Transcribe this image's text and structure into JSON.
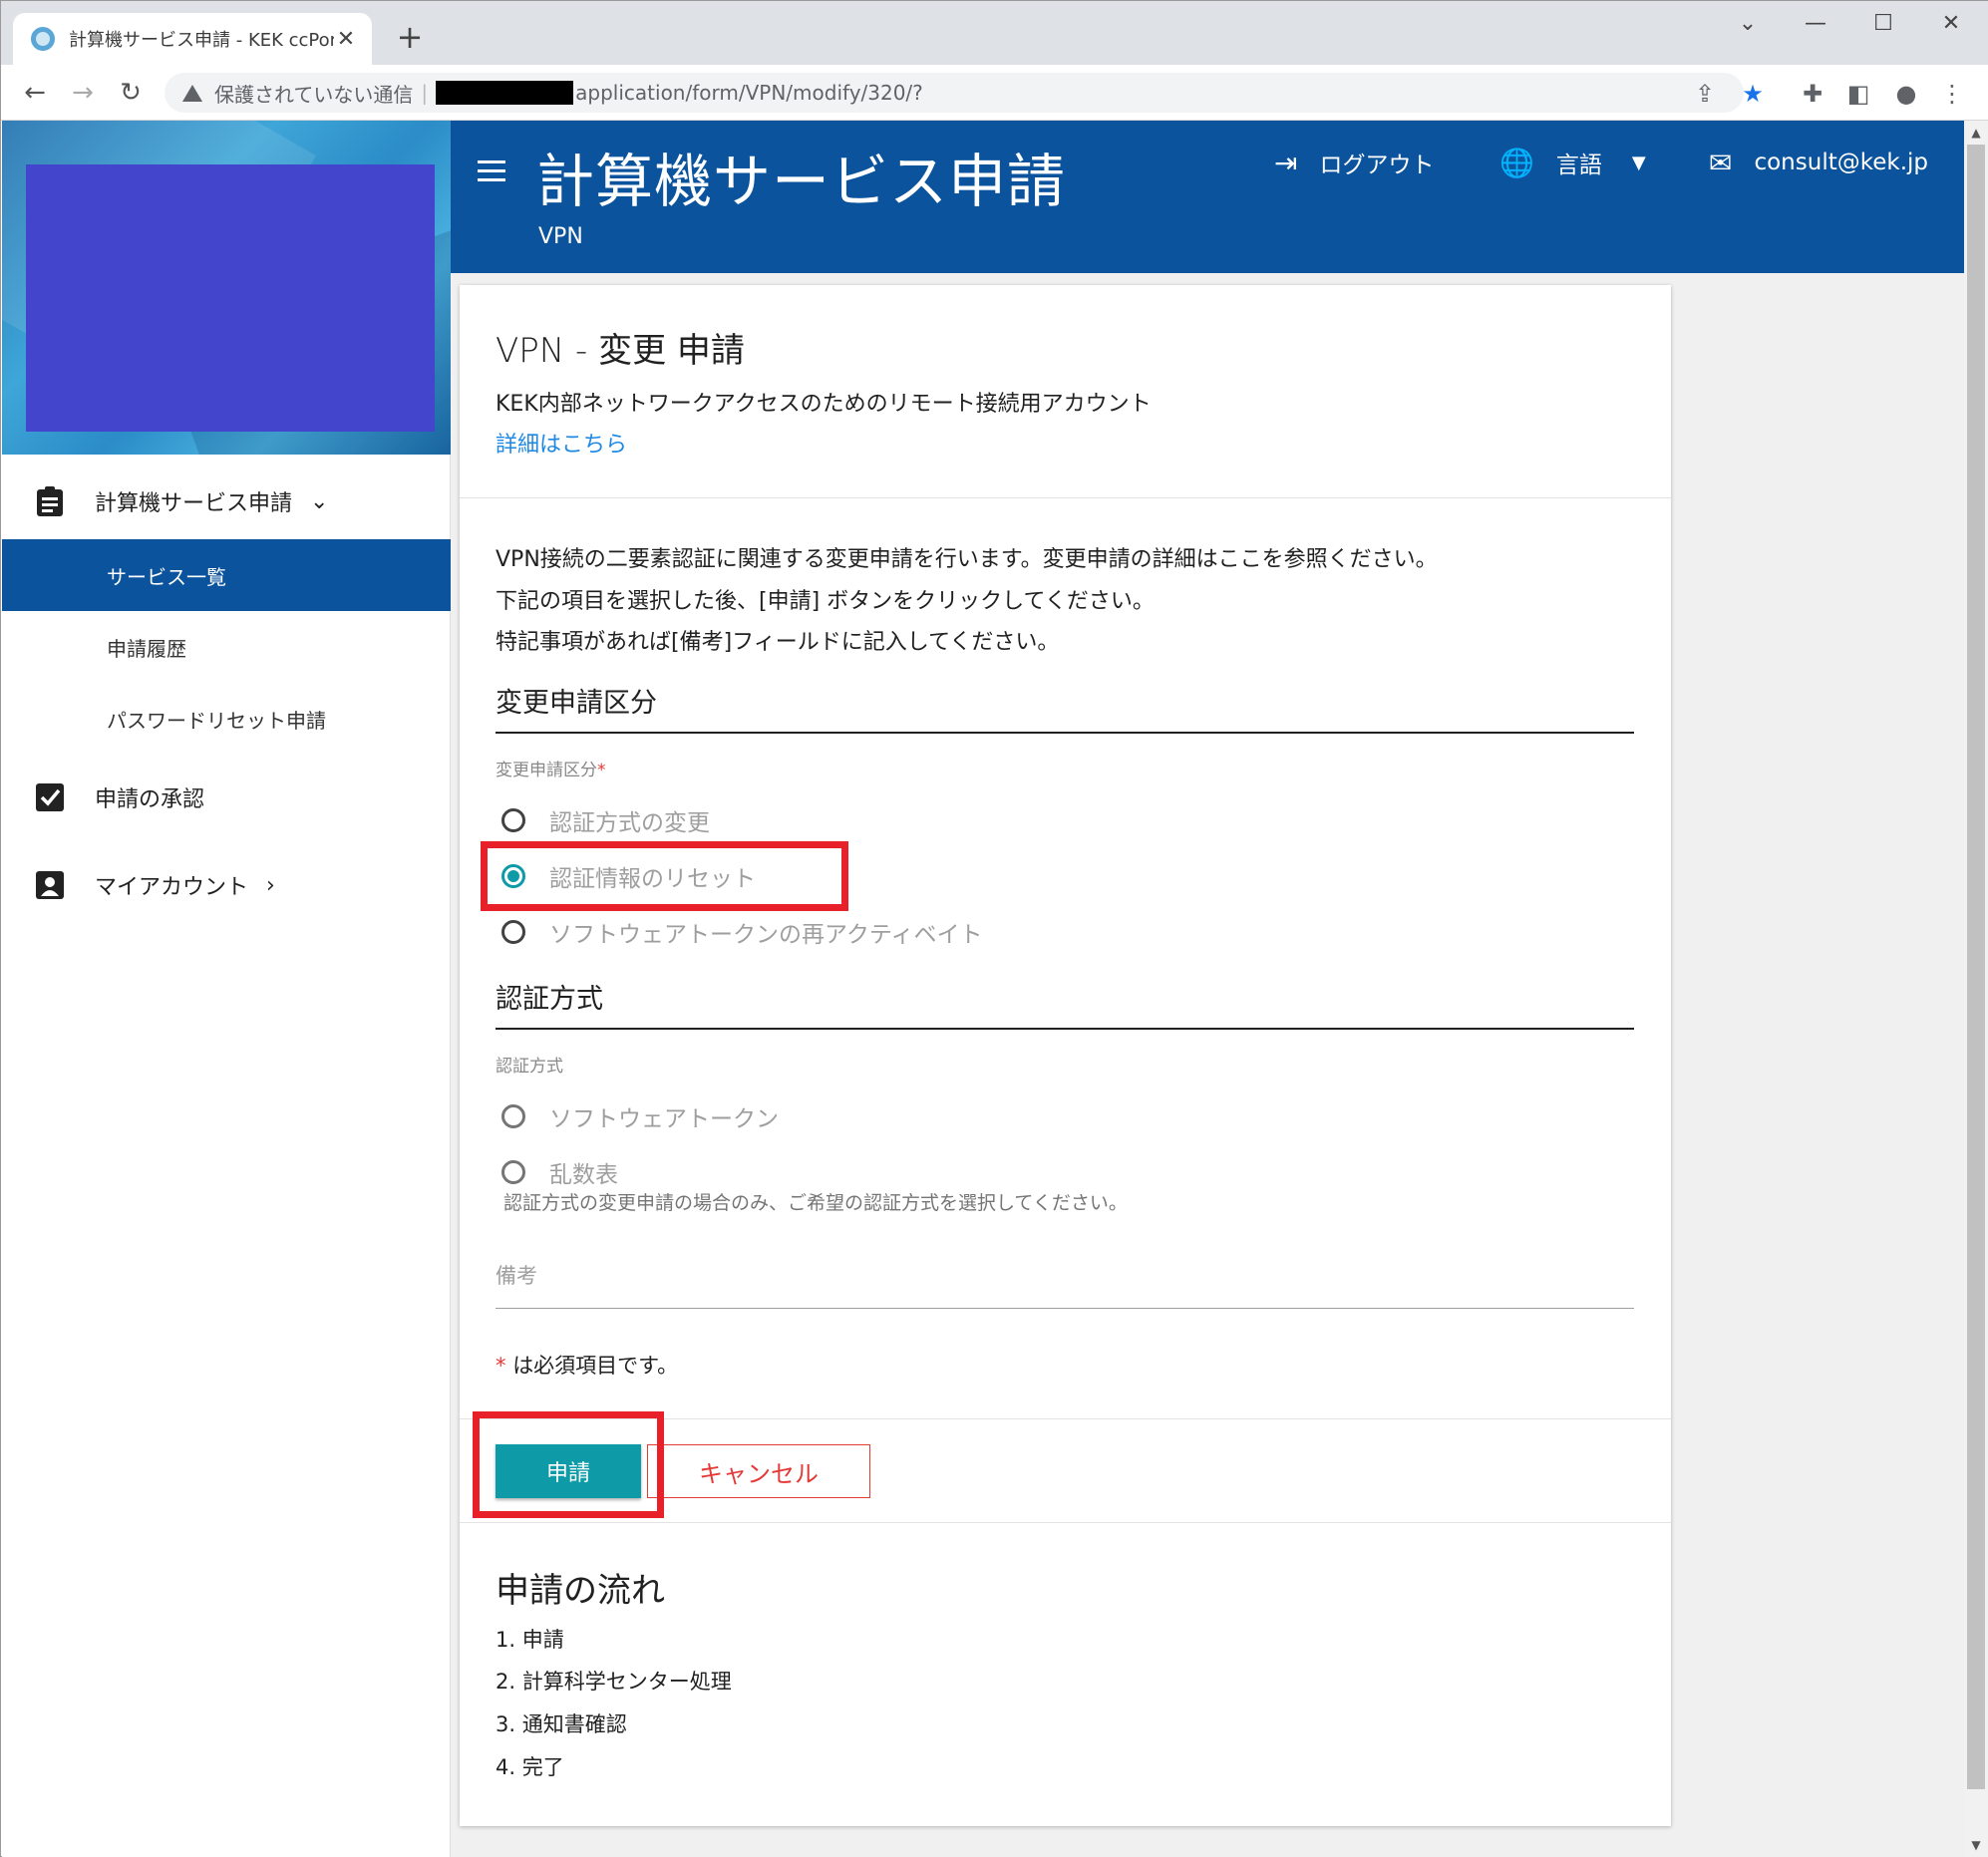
{
  "browser": {
    "tab_title": "計算機サービス申請 - KEK ccPortal",
    "tab_close": "✕",
    "new_tab": "+",
    "security_label": "保護されていない通信",
    "url_path": "application/form/VPN/modify/320/?"
  },
  "sidebar": {
    "section_services": "計算機サービス申請",
    "items": [
      {
        "label": "サービス一覧",
        "active": true
      },
      {
        "label": "申請履歴",
        "active": false
      },
      {
        "label": "パスワードリセット申請",
        "active": false
      }
    ],
    "section_approval": "申請の承認",
    "section_account": "マイアカウント"
  },
  "header": {
    "title": "計算機サービス申請",
    "subtitle": "VPN",
    "logout": "ログアウト",
    "language": "言語",
    "email": "consult@kek.jp"
  },
  "card": {
    "title_prefix": "VPN - ",
    "title_main": "変更 申請",
    "description": "KEK内部ネットワークアクセスのためのリモート接続用アカウント",
    "details_link": "詳細はこちら",
    "intro_lines": [
      "VPN接続の二要素認証に関連する変更申請を行います。変更申請の詳細はここを参照ください。",
      "下記の項目を選択した後、[申請] ボタンをクリックしてください。",
      "特記事項があれば[備考]フィールドに記入してください。"
    ],
    "section1_title": "変更申請区分",
    "section1_label": "変更申請区分",
    "required_mark": "*",
    "change_options": [
      {
        "label": "認証方式の変更",
        "selected": false
      },
      {
        "label": "認証情報のリセット",
        "selected": true
      },
      {
        "label": "ソフトウェアトークンの再アクティベイト",
        "selected": false
      }
    ],
    "section2_title": "認証方式",
    "section2_label": "認証方式",
    "auth_options": [
      {
        "label": "ソフトウェアトークン",
        "selected": false
      },
      {
        "label": "乱数表",
        "selected": false
      }
    ],
    "auth_hint": "認証方式の変更申請の場合のみ、ご希望の認証方式を選択してください。",
    "remarks_label": "備考",
    "required_note": "は必須項目です。",
    "submit": "申請",
    "cancel": "キャンセル",
    "flow_title": "申請の流れ",
    "flow_steps": [
      "1. 申請",
      "2. 計算科学センター処理",
      "3. 通知書確認",
      "4. 完了"
    ]
  },
  "colors": {
    "header_bg": "#0b539c",
    "accent_teal": "#0e9aa7",
    "cancel_red": "#e53935",
    "highlight_red": "#e8202a",
    "logo_block": "#4346cc"
  }
}
